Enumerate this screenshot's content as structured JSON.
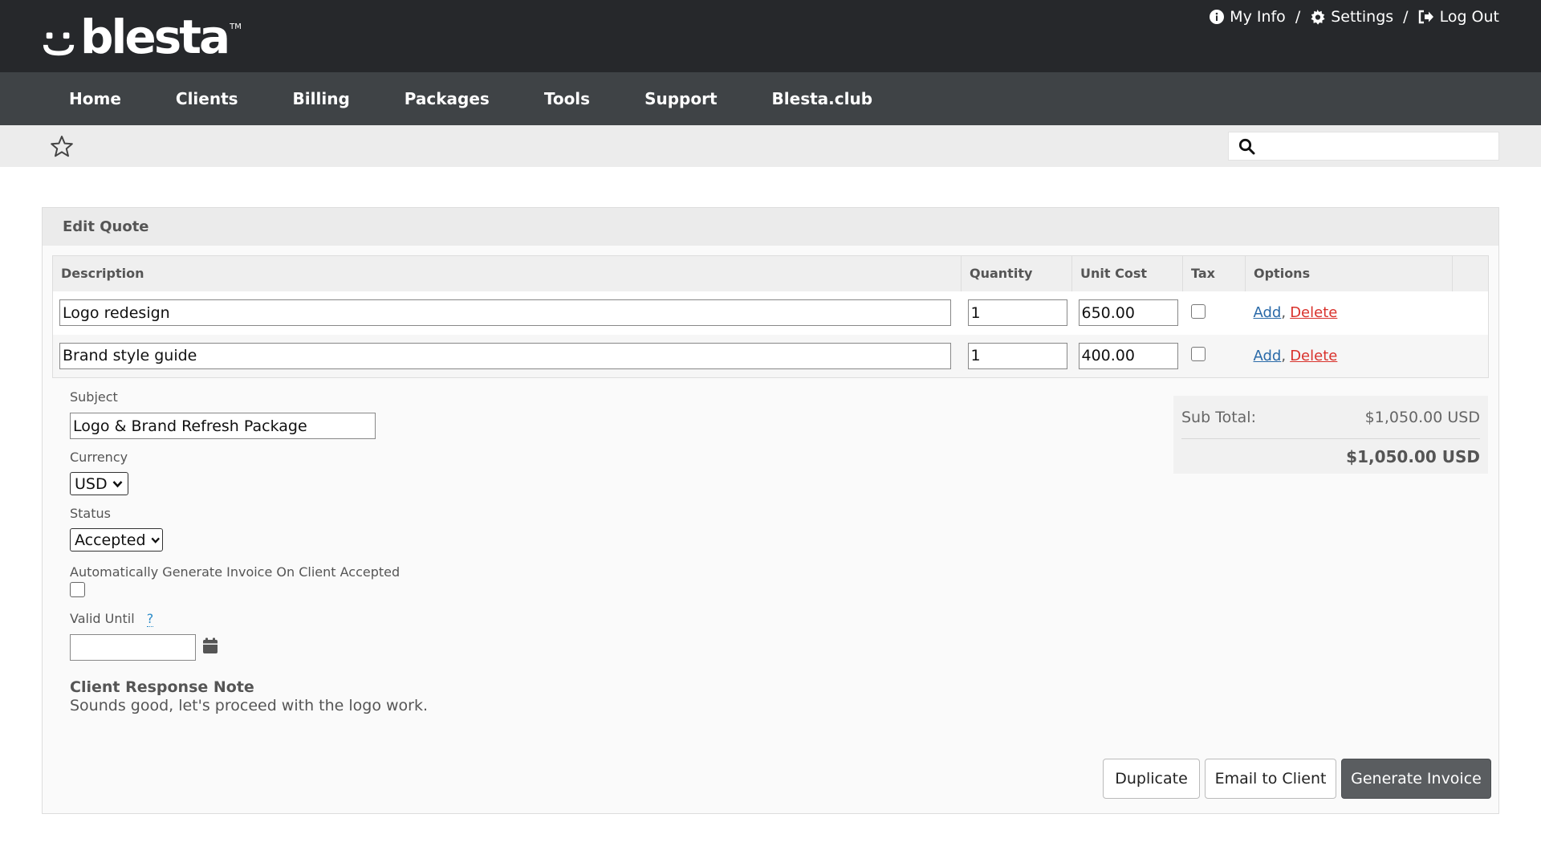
{
  "brand": {
    "logo_text": "blesta",
    "tm": "TM"
  },
  "top_links": {
    "my_info": "My Info",
    "settings": "Settings",
    "logout": "Log Out",
    "sep": "/"
  },
  "nav": {
    "items": [
      "Home",
      "Clients",
      "Billing",
      "Packages",
      "Tools",
      "Support",
      "Blesta.club"
    ]
  },
  "search": {
    "value": ""
  },
  "panel": {
    "title": "Edit Quote"
  },
  "items_table": {
    "headers": [
      "Description",
      "Quantity",
      "Unit Cost",
      "Tax",
      "Options",
      ""
    ],
    "rows": [
      {
        "description": "Logo redesign",
        "quantity": "1",
        "unit_cost": "650.00",
        "tax": false,
        "add": "Add",
        "comma": ",",
        "delete": "Delete"
      },
      {
        "description": "Brand style guide",
        "quantity": "1",
        "unit_cost": "400.00",
        "tax": false,
        "add": "Add",
        "comma": ",",
        "delete": "Delete"
      }
    ]
  },
  "form": {
    "subject_label": "Subject",
    "subject_value": "Logo & Brand Refresh Package",
    "currency_label": "Currency",
    "currency_value": "USD",
    "status_label": "Status",
    "status_value": "Accepted",
    "auto_invoice_label": "Automatically Generate Invoice On Client Accepted",
    "auto_invoice_checked": false,
    "valid_until_label": "Valid Until",
    "valid_until_help": "?",
    "valid_until_value": ""
  },
  "note": {
    "title": "Client Response Note",
    "body": "Sounds good, let's proceed with the logo work."
  },
  "totals": {
    "subtotal_label": "Sub Total:",
    "subtotal_value": "$1,050.00 USD",
    "total_value": "$1,050.00 USD"
  },
  "buttons": {
    "duplicate": "Duplicate",
    "email": "Email to Client",
    "generate": "Generate Invoice"
  },
  "colors": {
    "topbar": "#26282b",
    "navbar": "#3f4346",
    "link_add": "#2a6aa8",
    "link_delete": "#d9322c",
    "primary_button": "#5a5d60"
  }
}
